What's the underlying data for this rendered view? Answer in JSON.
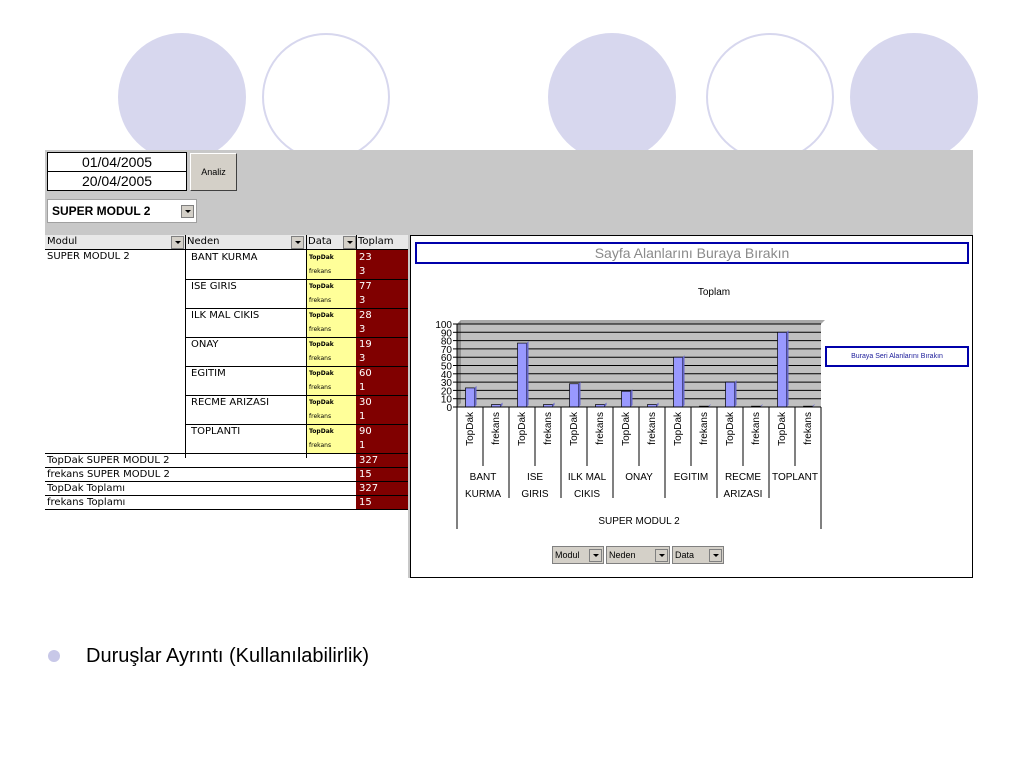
{
  "toolbar": {
    "start_date": "01/04/2005",
    "end_date": "20/04/2005",
    "analiz_label": "Analiz",
    "module_select": "SUPER MODUL 2"
  },
  "pivot": {
    "headers": [
      "Modul",
      "Neden",
      "Data",
      "Toplam"
    ],
    "modul": "SUPER MODUL 2",
    "rows": [
      {
        "neden": "BANT KURMA",
        "topdak": "23",
        "frekans": "3"
      },
      {
        "neden": "ISE GIRIS",
        "topdak": "77",
        "frekans": "3"
      },
      {
        "neden": "ILK MAL CIKIS",
        "topdak": "28",
        "frekans": "3"
      },
      {
        "neden": "ONAY",
        "topdak": "19",
        "frekans": "3"
      },
      {
        "neden": "EGITIM",
        "topdak": "60",
        "frekans": "1"
      },
      {
        "neden": "RECME ARIZASI",
        "topdak": "30",
        "frekans": "1"
      },
      {
        "neden": "TOPLANTI",
        "topdak": "90",
        "frekans": "1"
      }
    ],
    "data_labels": {
      "topdak": "TopDak",
      "frekans": "frekans"
    },
    "totals": [
      {
        "label": "TopDak SUPER MODUL 2",
        "value": "327"
      },
      {
        "label": "frekans SUPER MODUL 2",
        "value": "15"
      },
      {
        "label": "TopDak Toplamı",
        "value": "327"
      },
      {
        "label": "frekans Toplamı",
        "value": "15"
      }
    ]
  },
  "chart_area": {
    "page_fields_text": "Sayfa Alanlarını Buraya Bırakın",
    "series_drop_text": "Buraya Seri Alanlarını Bırakın",
    "buttons": [
      "Modul",
      "Neden",
      "Data"
    ]
  },
  "chart_data": {
    "type": "bar",
    "title": "Toplam",
    "group_label": "SUPER MODUL 2",
    "ylim": [
      0,
      100
    ],
    "yticks": [
      0,
      10,
      20,
      30,
      40,
      50,
      60,
      70,
      80,
      90,
      100
    ],
    "categories": [
      {
        "label_lines": [
          "BANT",
          "KURMA"
        ],
        "topdak": 23,
        "frekans": 3
      },
      {
        "label_lines": [
          "ISE",
          "GIRIS"
        ],
        "topdak": 77,
        "frekans": 3
      },
      {
        "label_lines": [
          "ILK MAL",
          "CIKIS"
        ],
        "topdak": 28,
        "frekans": 3
      },
      {
        "label_lines": [
          "ONAY"
        ],
        "topdak": 19,
        "frekans": 3
      },
      {
        "label_lines": [
          "EGITIM"
        ],
        "topdak": 60,
        "frekans": 1
      },
      {
        "label_lines": [
          "RECME",
          "ARIZASI"
        ],
        "topdak": 30,
        "frekans": 1
      },
      {
        "label_lines": [
          "TOPLANT"
        ],
        "topdak": 90,
        "frekans": 1
      }
    ],
    "sub_labels": [
      "TopDak",
      "frekans"
    ],
    "bar_color": "#9999ff",
    "plot_bg": "#c0c0c0",
    "grid": true
  },
  "slide": {
    "bullet_text": "Duruşlar Ayrıntı (Kullanılabilirlik)",
    "accent_color": "#d7d7ee"
  }
}
